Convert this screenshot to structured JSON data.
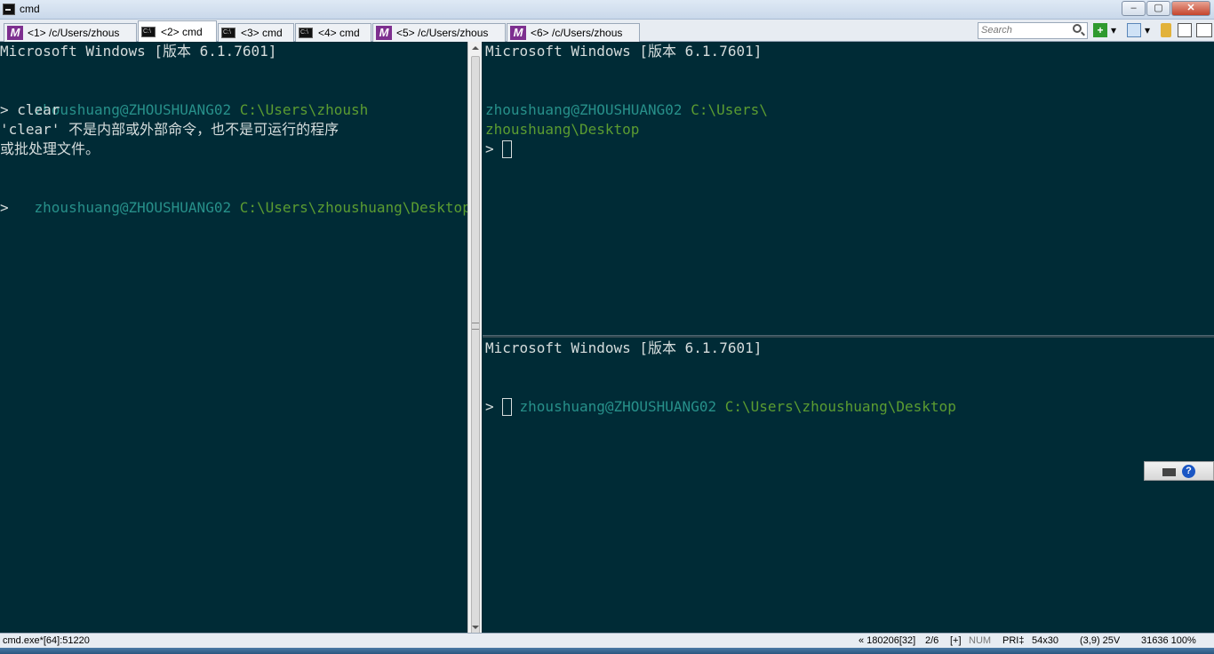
{
  "window": {
    "title": "cmd",
    "controls": {
      "minimize": "–",
      "maximize": "▢",
      "close": "✕"
    }
  },
  "tabs": [
    {
      "label": "<1> /c/Users/zhous",
      "icon": "m-icon",
      "active": false
    },
    {
      "label": "<2> cmd",
      "icon": "console-icon",
      "active": true
    },
    {
      "label": "<3> cmd",
      "icon": "console-icon",
      "active": false
    },
    {
      "label": "<4> cmd",
      "icon": "console-icon",
      "active": false
    },
    {
      "label": "<5> /c/Users/zhous",
      "icon": "m-icon",
      "active": false
    },
    {
      "label": "<6> /c/Users/zhous",
      "icon": "m-icon",
      "active": false
    }
  ],
  "toolbar": {
    "search_placeholder": "Search",
    "new_console": "+",
    "dropdown": "▾"
  },
  "panes": {
    "left": {
      "header": "Microsoft Windows [版本 6.1.7601]",
      "prompt1_user": "zhoushuang@ZHOUSHUANG02",
      "prompt1_path": "C:\\Users\\zhoush",
      "command": "> clear",
      "error_line1": "'clear' 不是内部或外部命令，也不是可运行的程序",
      "error_line2": "或批处理文件。",
      "prompt2_user": "zhoushuang@ZHOUSHUANG02",
      "prompt2_path": "C:\\Users\\zhoushuang\\Desktop",
      "prompt_symbol": ">"
    },
    "top_right": {
      "header": "Microsoft Windows [版本 6.1.7601]",
      "prompt_user": "zhoushuang@ZHOUSHUANG02",
      "prompt_path_part1": "C:\\Users\\",
      "prompt_path_part2": "zhoushuang\\Desktop",
      "prompt_symbol": ">"
    },
    "bottom_right": {
      "header": "Microsoft Windows [版本 6.1.7601]",
      "prompt_user": "zhoushuang@ZHOUSHUANG02",
      "prompt_path": "C:\\Users\\zhoushuang\\Desktop",
      "prompt_symbol": ">"
    }
  },
  "langbar": {
    "help": "?"
  },
  "statusbar": {
    "process": "cmd.exe*[64]:51220",
    "position": "« 180206[32]",
    "console_index": "2/6",
    "add": "[+]",
    "num": "NUM",
    "pri": "PRI‡",
    "size": "54x30",
    "cursor": "(3,9) 25V",
    "pid_zoom": "31636 100%"
  },
  "colors": {
    "terminal_bg": "#002b36",
    "prompt_user": "#27908a",
    "prompt_path": "#5b9c31",
    "text": "#d5dcdc"
  }
}
